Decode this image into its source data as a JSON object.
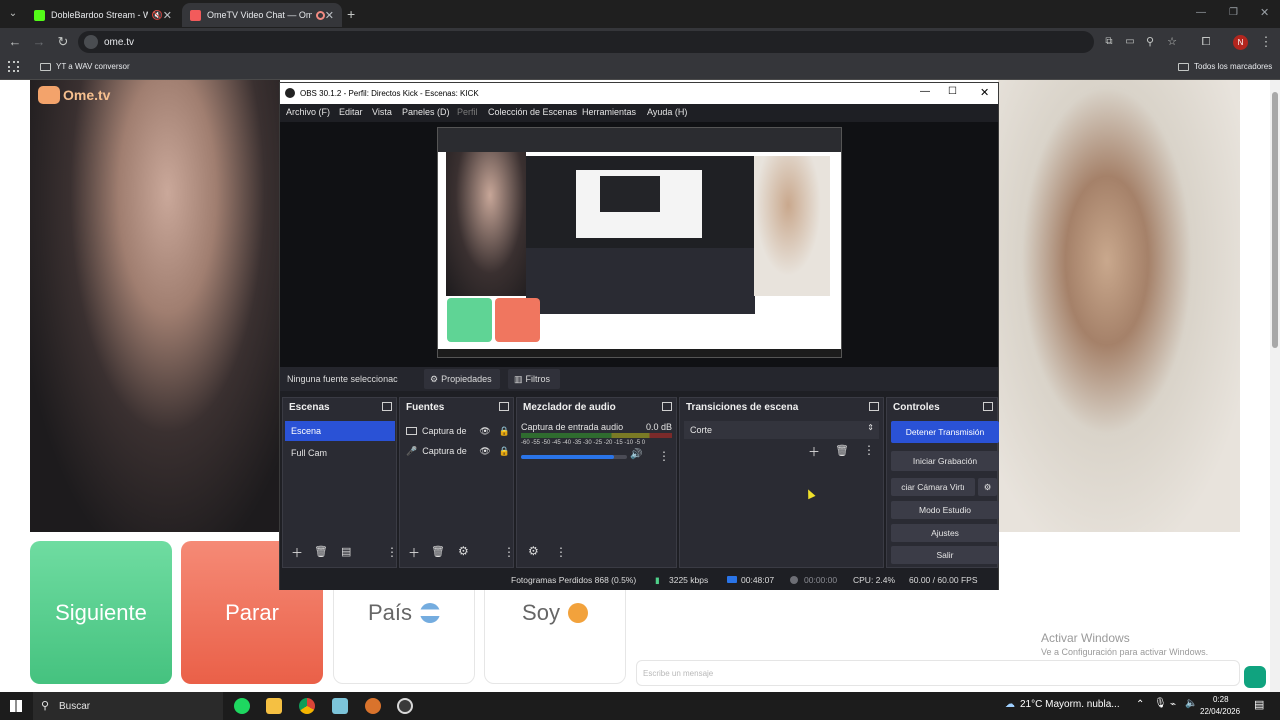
{
  "browser": {
    "tabs": [
      {
        "title": "DobleBardoo Stream - Watc",
        "active": false
      },
      {
        "title": "OmeTV Video Chat — Ome",
        "active": true
      }
    ],
    "new_tab": "+",
    "url": "ome.tv",
    "bookmarks": [
      {
        "label": "YT a WAV conversor"
      }
    ],
    "all_bookmarks": "Todos los marcadores",
    "profile_initial": "N"
  },
  "page": {
    "logo": "Ome.tv",
    "buttons": {
      "next": "Siguiente",
      "stop": "Parar",
      "country": "País",
      "self": "Soy"
    },
    "chat_placeholder": "Escribe un mensaje",
    "activate_windows": {
      "title": "Activar Windows",
      "subtitle": "Ve a Configuración para activar Windows."
    }
  },
  "obs": {
    "title": "OBS 30.1.2 - Perfil: Directos Kick - Escenas: KICK",
    "menu": [
      "Archivo (F)",
      "Editar",
      "Vista",
      "Paneles (D)",
      "Perfil",
      "Colección de Escenas",
      "Herramientas",
      "Ayuda (H)"
    ],
    "no_source": "Ninguna fuente seleccionac",
    "properties": "Propiedades",
    "filters": "Filtros",
    "scenes": {
      "title": "Escenas",
      "items": [
        "Escena",
        "Full Cam"
      ]
    },
    "sources": {
      "title": "Fuentes",
      "items": [
        "Captura de",
        "Captura de"
      ]
    },
    "mixer": {
      "title": "Mezclador de audio",
      "track": "Captura de entrada audio",
      "level": "0.0 dB",
      "scale": "-60 -55 -50 -45 -40 -35 -30 -25 -20 -15 -10 -5 0",
      "volume_fraction": 0.88
    },
    "transitions": {
      "title": "Transiciones de escena",
      "selected": "Corte"
    },
    "controls": {
      "title": "Controles",
      "stop_stream": "Detener Transmisión",
      "start_recording": "Iniciar Grabación",
      "virtual_cam": "ciar Cámara Virtı",
      "studio_mode": "Modo Estudio",
      "settings": "Ajustes",
      "exit": "Salir"
    },
    "status": {
      "dropped": "Fotogramas Perdidos 868 (0.5%)",
      "bitrate": "3225 kbps",
      "stream_time": "00:48:07",
      "rec_time": "00:00:00",
      "cpu": "CPU: 2.4%",
      "fps": "60.00 / 60.00 FPS"
    }
  },
  "taskbar": {
    "search": "Buscar",
    "weather": "21°C  Mayorm. nubla...",
    "time": "0:28",
    "date": "22/04/2026"
  },
  "colors": {
    "next_green": "#4fd08a",
    "stop_red": "#f1705a",
    "obs_accent": "#2a52d6",
    "obs_bg": "#1e1f24"
  }
}
